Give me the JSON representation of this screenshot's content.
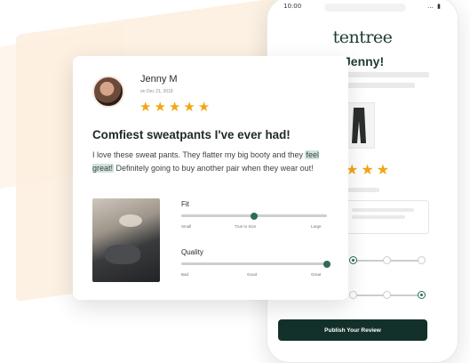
{
  "phone": {
    "status_time": "10:00",
    "status_icons": "… ▮",
    "brand": "tentree",
    "greeting": "Jenny!",
    "stars": "★★★",
    "publish_button": "Publish Your Review"
  },
  "review": {
    "name": "Jenny M",
    "date": "on Dec 21, 2018",
    "stars": "★★★★★",
    "rating": 5,
    "title": "Comfiest sweatpants I've ever had!",
    "body_pre": "I love these sweat pants. They flatter my big booty and they ",
    "body_highlight": "feel great!",
    "body_post": " Definitely going to buy another pair when they wear out!",
    "fit": {
      "label": "Fit",
      "value": 0.5,
      "ticks": [
        "Small",
        "True to Size",
        "Large"
      ]
    },
    "quality": {
      "label": "Quality",
      "value": 1.0,
      "ticks": [
        "Bad",
        "Good",
        "Great"
      ]
    }
  },
  "colors": {
    "accent_green": "#2f6b57",
    "dark_green": "#13312a",
    "star_gold": "#f3a514",
    "highlight": "#cfe3dc"
  }
}
